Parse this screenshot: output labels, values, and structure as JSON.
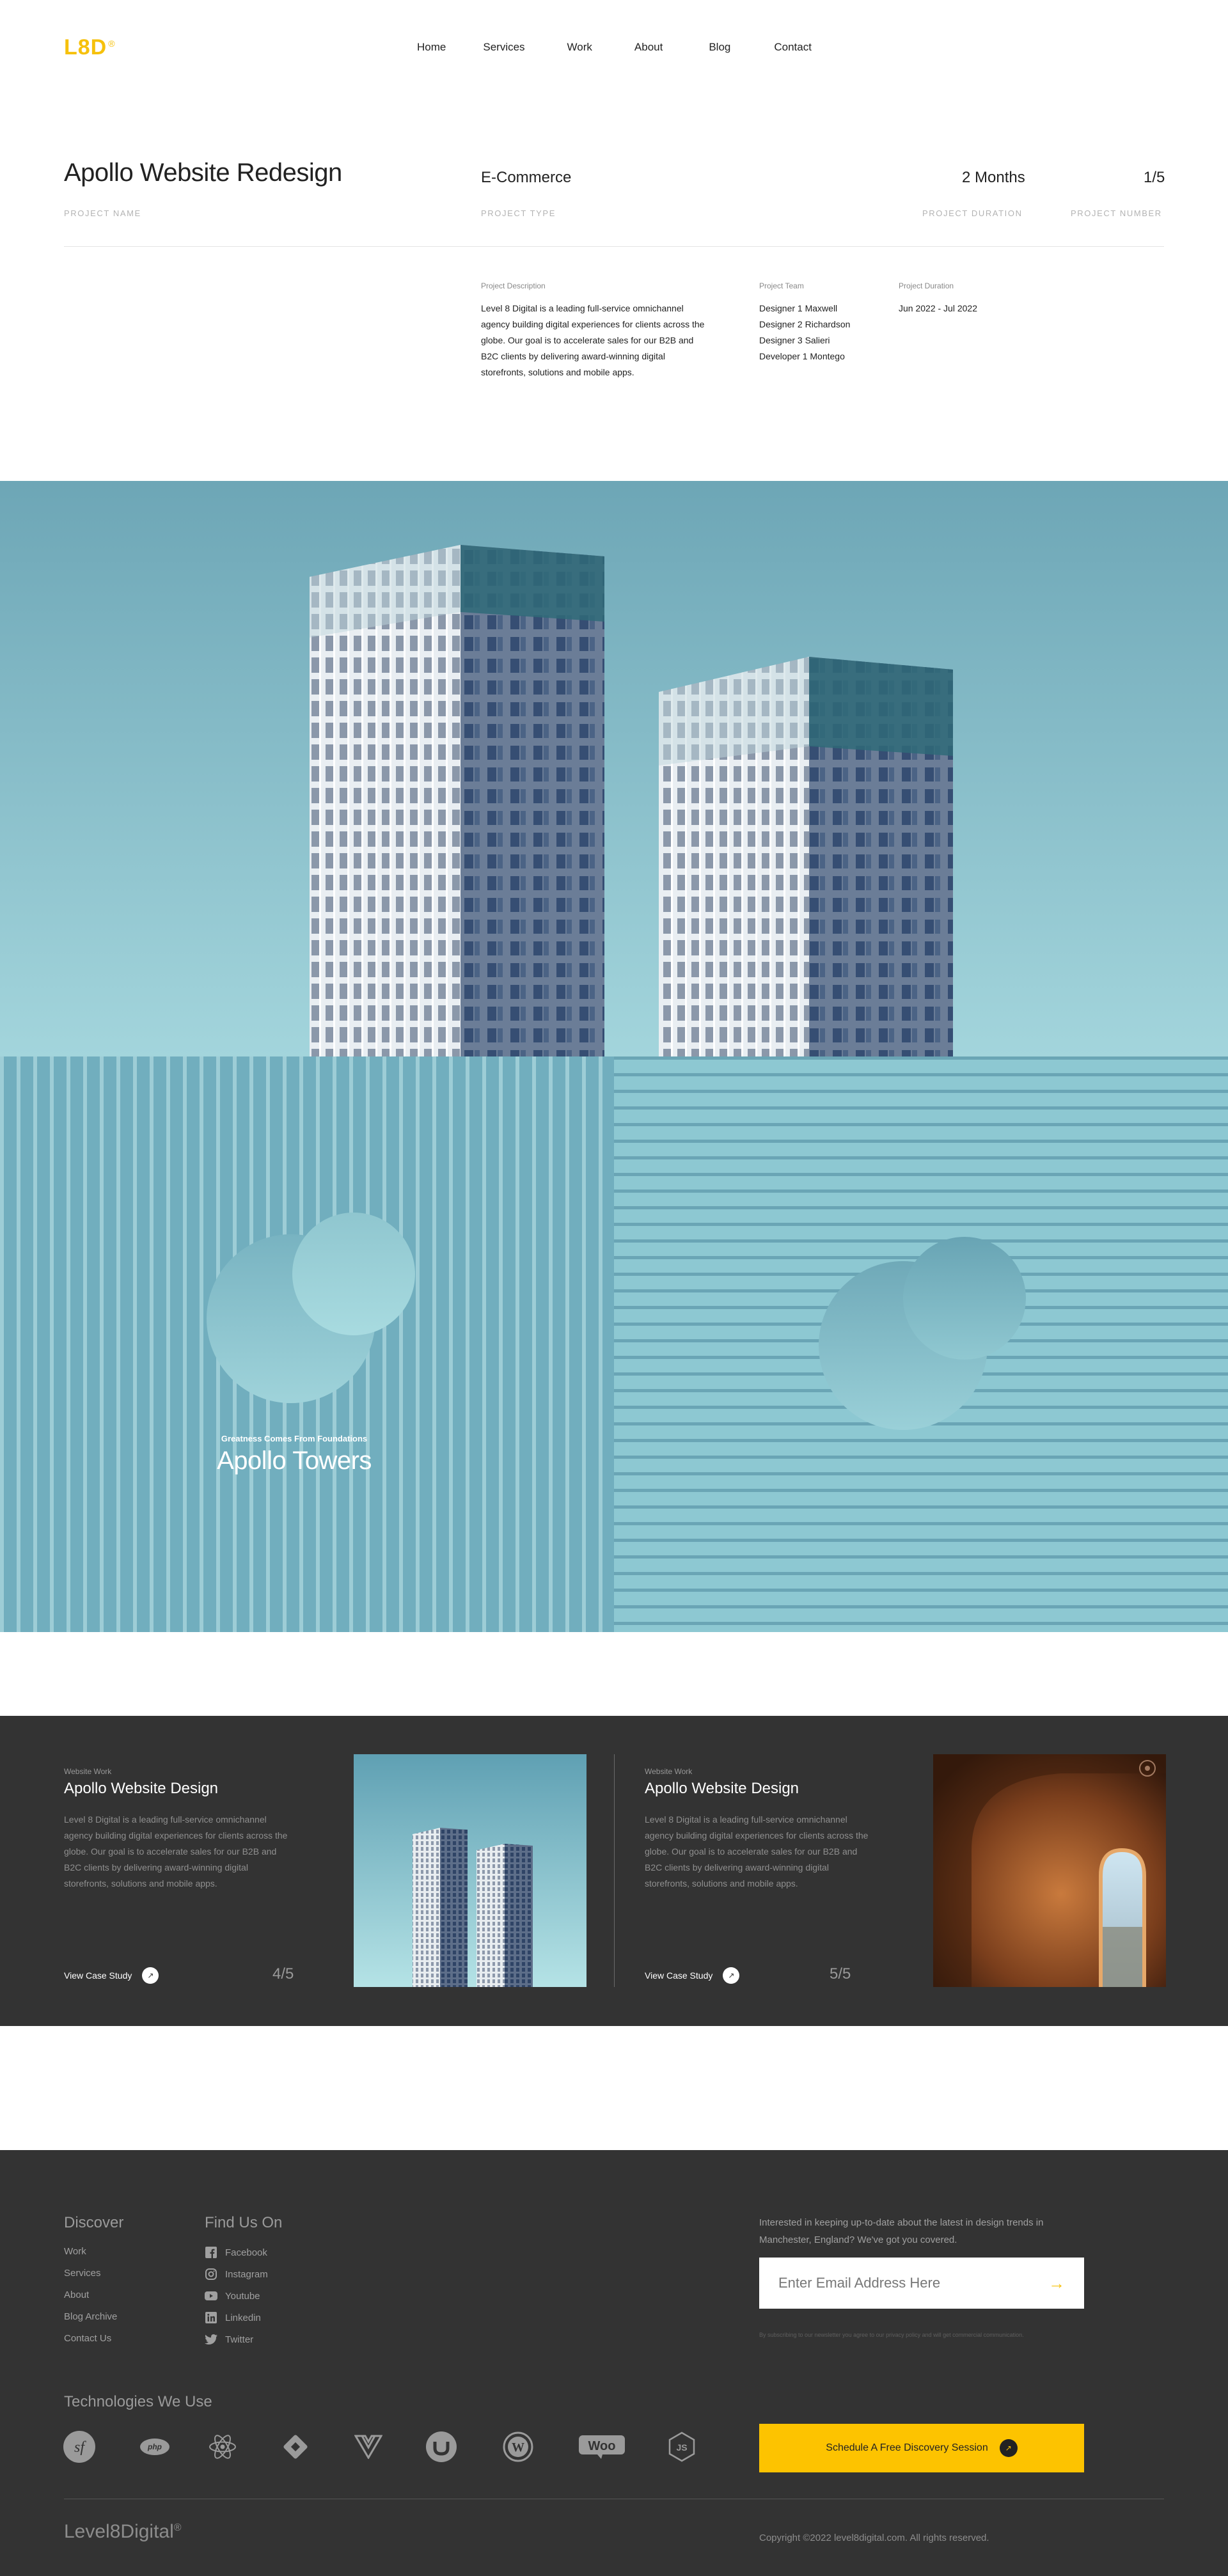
{
  "brand": {
    "logo": "L8D",
    "logo_mark": "®",
    "accent": "#f6c10c"
  },
  "nav": [
    "Home",
    "Services",
    "Work",
    "About",
    "Blog",
    "Contact"
  ],
  "project": {
    "name": "Apollo Website Redesign",
    "name_label": "PROJECT NAME",
    "type": "E-Commerce",
    "type_label": "PROJECT TYPE",
    "duration": "2 Months",
    "duration_label": "PROJECT DURATION",
    "number": "1/5",
    "number_label": "PROJECT NUMBER",
    "description_label": "Project Description",
    "description": "Level 8 Digital is a leading full-service omnichannel agency building digital experiences for clients across the globe. Our goal is to accelerate sales for our B2B and B2C clients by delivering award-winning digital storefronts, solutions and mobile apps.",
    "team_label": "Project Team",
    "team": [
      "Designer 1 Maxwell",
      "Designer 2 Richardson",
      "Designer 3 Salieri",
      "Developer 1 Montego"
    ],
    "dates_label": "Project Duration",
    "dates": "Jun 2022 - Jul 2022"
  },
  "feature": {
    "kicker": "Greatness Comes From Foundations",
    "title": "Apollo Towers"
  },
  "work_cards": [
    {
      "kicker": "Website Work",
      "title": "Apollo Website Design",
      "text": "Level 8 Digital is a leading full-service omnichannel agency building digital experiences for clients across the globe. Our goal is to accelerate sales for our B2B and B2C clients by delivering award-winning digital storefronts, solutions and mobile apps.",
      "cta": "View Case Study",
      "number": "4/5"
    },
    {
      "kicker": "Website Work",
      "title": "Apollo Website Design",
      "text": "Level 8 Digital is a leading full-service omnichannel agency building digital experiences for clients across the globe. Our goal is to accelerate sales for our B2B and B2C clients by delivering award-winning digital storefronts, solutions and mobile apps.",
      "cta": "View Case Study",
      "number": "5/5"
    }
  ],
  "footer": {
    "discover_title": "Discover",
    "discover": [
      "Work",
      "Services",
      "About",
      "Blog Archive",
      "Contact Us"
    ],
    "find_title": "Find Us On",
    "social": [
      {
        "label": "Facebook",
        "icon": "facebook-icon"
      },
      {
        "label": "Instagram",
        "icon": "instagram-icon"
      },
      {
        "label": "Youtube",
        "icon": "youtube-icon"
      },
      {
        "label": "Linkedin",
        "icon": "linkedin-icon"
      },
      {
        "label": "Twitter",
        "icon": "twitter-icon"
      }
    ],
    "newsletter_text": "Interested in keeping up-to-date about the latest in design trends in Manchester, England? We've got you covered.",
    "email_placeholder": "Enter Email Address Here",
    "newsletter_fine": "By subscribing to our newsletter you agree to our privacy policy and will get commercial communication.",
    "tech_title": "Technologies We Use",
    "tech": [
      "symfony-icon",
      "php-icon",
      "react-icon",
      "diamond-icon",
      "vue-icon",
      "umbraco-icon",
      "wordpress-icon",
      "woocommerce-icon",
      "nodejs-icon"
    ],
    "cta": "Schedule A Free Discovery Session",
    "brand": "Level8Digital",
    "brand_mark": "®",
    "copyright": "Copyright ©2022 level8digital.com. All rights reserved."
  }
}
